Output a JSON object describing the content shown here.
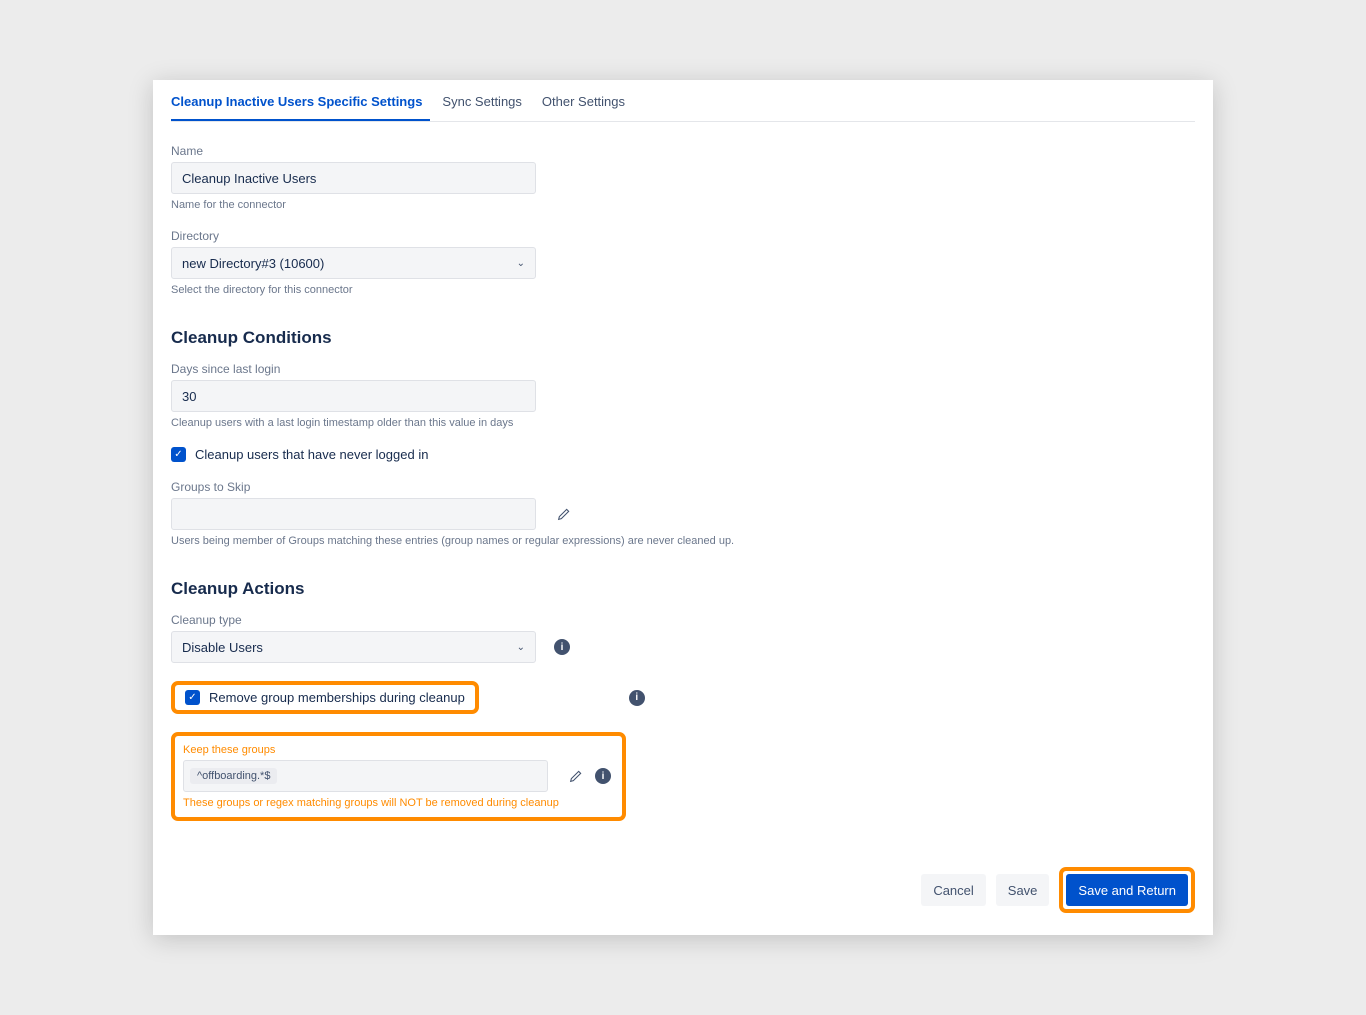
{
  "tabs": {
    "items": [
      {
        "label": "Cleanup Inactive Users Specific Settings",
        "active": true
      },
      {
        "label": "Sync Settings",
        "active": false
      },
      {
        "label": "Other Settings",
        "active": false
      }
    ]
  },
  "name_field": {
    "label": "Name",
    "value": "Cleanup Inactive Users",
    "helper": "Name for the connector"
  },
  "directory_field": {
    "label": "Directory",
    "value": "new Directory#3 (10600)",
    "helper": "Select the directory for this connector"
  },
  "conditions": {
    "title": "Cleanup Conditions",
    "days": {
      "label": "Days since last login",
      "value": "30",
      "helper": "Cleanup users with a last login timestamp older than this value in days"
    },
    "never_logged_in": {
      "label": "Cleanup users that have never logged in",
      "checked": true
    },
    "groups_skip": {
      "label": "Groups to Skip",
      "helper": "Users being member of Groups matching these entries (group names or regular expressions) are never cleaned up."
    }
  },
  "actions": {
    "title": "Cleanup Actions",
    "cleanup_type": {
      "label": "Cleanup type",
      "value": "Disable Users"
    },
    "remove_group": {
      "label": "Remove group memberships during cleanup",
      "checked": true
    },
    "keep_groups": {
      "label": "Keep these groups",
      "chip": "^offboarding.*$",
      "helper": "These groups or regex matching groups will NOT be removed during cleanup"
    }
  },
  "footer": {
    "cancel": "Cancel",
    "save": "Save",
    "save_return": "Save and Return"
  }
}
